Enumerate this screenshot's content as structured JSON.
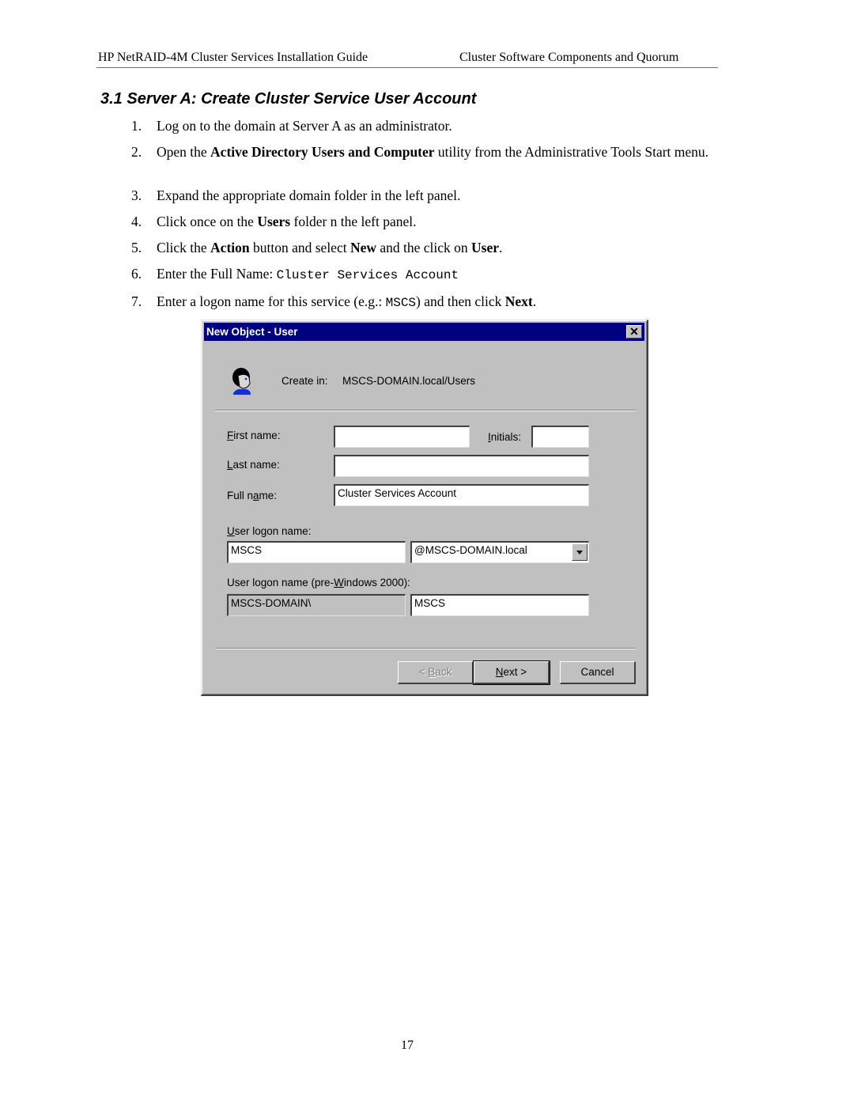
{
  "header": {
    "left": "HP NetRAID-4M Cluster Services Installation Guide",
    "right": "Cluster Software Components and Quorum"
  },
  "section": {
    "title": "3.1  Server A: Create Cluster Service User Account"
  },
  "steps": [
    {
      "num": "1.",
      "parts": [
        {
          "t": "Log on to the domain at Server A as an administrator."
        }
      ]
    },
    {
      "num": "2.",
      "parts": [
        {
          "t": "Open the "
        },
        {
          "t": "Active Directory Users and Computer",
          "b": true
        },
        {
          "t": " utility from the Administrative Tools Start menu."
        }
      ]
    },
    {
      "num": "3.",
      "parts": [
        {
          "t": "Expand the appropriate domain folder in the left panel."
        }
      ]
    },
    {
      "num": "4.",
      "parts": [
        {
          "t": "Click once on the "
        },
        {
          "t": "Users",
          "b": true
        },
        {
          "t": " folder n the left panel."
        }
      ]
    },
    {
      "num": "5.",
      "parts": [
        {
          "t": "Click the "
        },
        {
          "t": "Action",
          "b": true
        },
        {
          "t": " button and select "
        },
        {
          "t": "New",
          "b": true
        },
        {
          "t": " and the click on "
        },
        {
          "t": "User",
          "b": true
        },
        {
          "t": "."
        }
      ]
    },
    {
      "num": "6.",
      "parts": [
        {
          "t": "Enter the Full Name: "
        },
        {
          "t": "Cluster Services Account",
          "m": true
        }
      ]
    },
    {
      "num": "7.",
      "parts": [
        {
          "t": "Enter a logon name for this service (e.g.:  "
        },
        {
          "t": "MSCS",
          "m": true
        },
        {
          "t": ") and then click "
        },
        {
          "t": "Next",
          "b": true
        },
        {
          "t": "."
        }
      ]
    }
  ],
  "dialog": {
    "title": "New Object - User",
    "close_icon": "close-icon",
    "create_in_label": "Create in:",
    "create_in_value": "MSCS-DOMAIN.local/Users",
    "first_name": {
      "label_u": "F",
      "label_rest": "irst name:",
      "value": ""
    },
    "initials": {
      "label_u": "I",
      "label_rest": "nitials:",
      "value": ""
    },
    "last_name": {
      "label_u": "L",
      "label_rest": "ast name:",
      "value": ""
    },
    "full_name": {
      "label_pre": "Full n",
      "label_u": "a",
      "label_rest": "me:",
      "value": "Cluster Services Account"
    },
    "logon_name": {
      "label_u": "U",
      "label_rest": "ser logon name:",
      "value": "MSCS",
      "domain_selected": "@MSCS-DOMAIN.local"
    },
    "pre2000": {
      "label_pre": "User logon name (pre-",
      "label_u": "W",
      "label_rest": "indows 2000):",
      "domain": "MSCS-DOMAIN\\",
      "value": "MSCS"
    },
    "buttons": {
      "back": {
        "pre": "< ",
        "u": "B",
        "rest": "ack"
      },
      "next": {
        "u": "N",
        "rest": "ext >"
      },
      "cancel": "Cancel"
    }
  },
  "page_number": "17"
}
